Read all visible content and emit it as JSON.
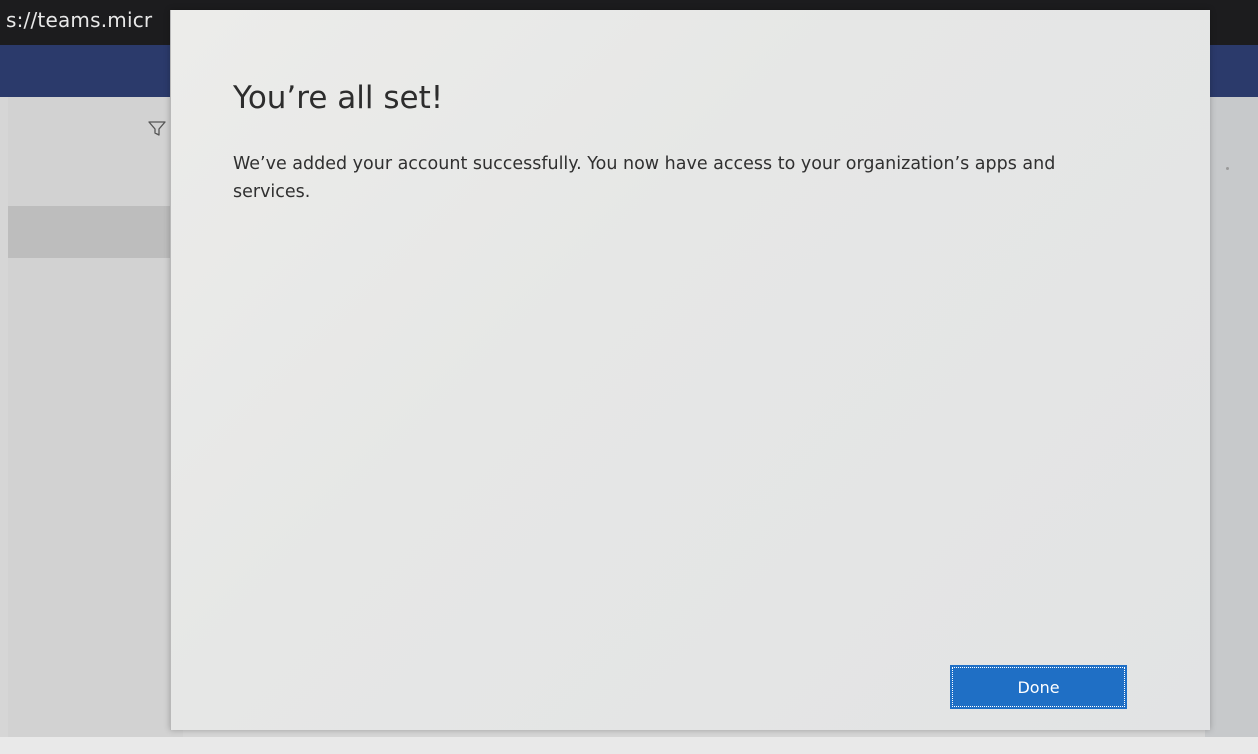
{
  "browser": {
    "url_fragment": "s://teams.micr"
  },
  "background": {
    "filter_icon": "filter-icon"
  },
  "dialog": {
    "title": "You’re all set!",
    "message": "We’ve added your account successfully. You now have access to your organization’s apps and services.",
    "done_label": "Done"
  },
  "colors": {
    "accent": "#1f6fc5",
    "navbar": "#2b3a6b"
  }
}
